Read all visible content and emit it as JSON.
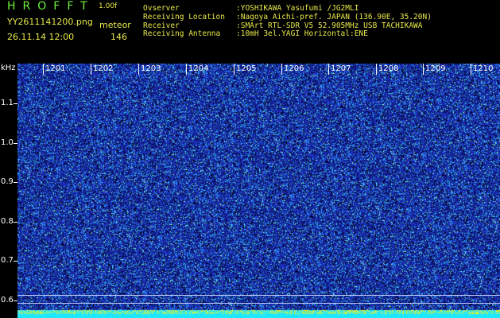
{
  "header": {
    "app_title": "HROFFT",
    "version": "1.00f",
    "filename": "YY2611141200.png",
    "mode_label": "meteor",
    "timestamp": "26.11.14 12:00",
    "count": "146"
  },
  "station_info": [
    {
      "key": "Ovserver",
      "value": ":YOSHIKAWA Yasufumi /JG2MLI"
    },
    {
      "key": "Receiving Location",
      "value": ":Nagoya Aichi-pref. JAPAN (136.90E, 35.20N)"
    },
    {
      "key": "Receiver",
      "value": ":SMArt RTL-SDR V5 52.905MHz USB TACHIKAWA"
    },
    {
      "key": "Receiving Antenna",
      "value": ":10mH 3el.YAGI Horizontal:ENE"
    }
  ],
  "plot": {
    "unit_label": "kHz",
    "y_labels": [
      "1.1",
      "1.0",
      "0.9",
      "0.8",
      "0.7",
      "0.6"
    ],
    "time_labels": [
      "1201",
      "1202",
      "1203",
      "1204",
      "1205",
      "1206",
      "1207",
      "1208",
      "1209",
      "1210"
    ],
    "colors": {
      "background": "#1a2aa6",
      "speckle_light": "#35c8ff",
      "speckle_dark": "#000020",
      "bottom_strip": "#1ee8ff",
      "bottom_strip_alt": "#f0f020"
    }
  }
}
